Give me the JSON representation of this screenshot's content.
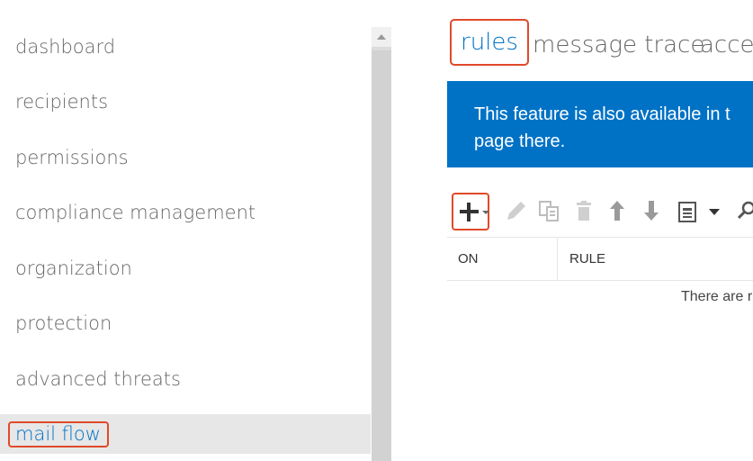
{
  "nav": {
    "items": [
      {
        "label": "dashboard"
      },
      {
        "label": "recipients"
      },
      {
        "label": "permissions"
      },
      {
        "label": "compliance management"
      },
      {
        "label": "organization"
      },
      {
        "label": "protection"
      },
      {
        "label": "advanced threats"
      },
      {
        "label": "mail flow"
      }
    ]
  },
  "tabs": [
    {
      "label": "rules"
    },
    {
      "label": "message trace"
    },
    {
      "label": "accep"
    }
  ],
  "banner": {
    "line1": "This feature is also available in t",
    "line2": "page there."
  },
  "toolbar": {
    "icons": [
      "add-icon",
      "edit-icon",
      "copy-icon",
      "delete-icon",
      "move-up-icon",
      "move-down-icon",
      "report-icon",
      "search-icon"
    ]
  },
  "table": {
    "columns": [
      "ON",
      "RULE"
    ],
    "empty_text": "There are r"
  },
  "colors": {
    "accent": "#0072c6",
    "highlight_border": "#e04a2a",
    "selected_bg": "#e7e7e7"
  }
}
